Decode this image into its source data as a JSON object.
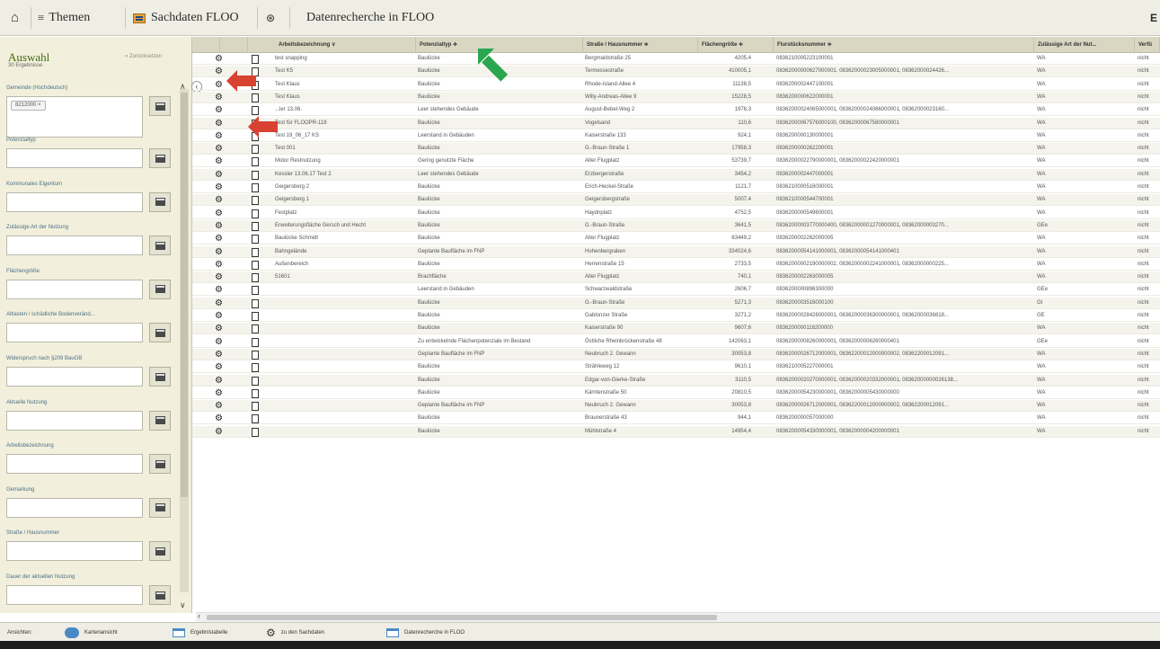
{
  "toolbar": {
    "themen": "Themen",
    "sachdaten": "Sachdaten FLOO",
    "title": "Datenrecherche in FLOO",
    "right_glyph": "E"
  },
  "sidebar": {
    "title": "Auswahl",
    "back": "« Zurücksetzen",
    "count": "30 Ergebnisse",
    "filters": [
      {
        "label": "Gemeinde (Hochdeutsch)",
        "chip": "8212000 ×"
      },
      {
        "label": "Potenzialtyp",
        "chip": ""
      },
      {
        "label": "Kommunales Eigentum",
        "chip": ""
      },
      {
        "label": "Zulässige Art der Nutzung",
        "chip": ""
      },
      {
        "label": "Flächengröße",
        "chip": ""
      },
      {
        "label": "Altlasten / schädliche Bodenveränd...",
        "chip": ""
      },
      {
        "label": "Widerspruch nach §209 BauGB",
        "chip": ""
      },
      {
        "label": "Aktuelle Nutzung",
        "chip": ""
      },
      {
        "label": "Arbeitsbezeichnung",
        "chip": ""
      },
      {
        "label": "Gemarkung",
        "chip": ""
      },
      {
        "label": "Straße / Hausnummer",
        "chip": ""
      },
      {
        "label": "Dauer der aktuellen Nutzung",
        "chip": ""
      }
    ]
  },
  "grid": {
    "headers": [
      "Arbeitsbezeichnung ∨",
      "Potenzialtyp ≑",
      "Straße / Hausnummer ≑",
      "Flächengröße ≑",
      "Flurstücksnummer ≑",
      "Zulässige Art der Nut...",
      "Verfü"
    ],
    "rows": [
      [
        "test snapping",
        "Baulücke",
        "Bergmaldstraße 25",
        "4205,4",
        "0836210005223100001",
        "WA",
        "nicht"
      ],
      [
        "Test K5",
        "Baulücke",
        "Termessestraße",
        "410005,1",
        "08362000000627000001, 08362000023005000001, 08362000024426...",
        "WA",
        "nicht"
      ],
      [
        "Test Klaus",
        "Baulücke",
        "Rhode-Island-Allee 4",
        "11138,5",
        "0836200002447100001",
        "WA",
        "nicht"
      ],
      [
        "Test Klaus",
        "Baulücke",
        "Willy-Andreas-Allee 9",
        "15228,5",
        "0836200000622000001",
        "WA",
        "nicht"
      ],
      [
        "...ler 13.06.",
        "Leer stehendes Gebäude",
        "August-Bebel-Weg 2",
        "1976,3",
        "08362000024065000001, 08362000024066000001, 08362000023160...",
        "WA",
        "nicht"
      ],
      [
        "Test für FLOOPR-118",
        "Baulücke",
        "Vogelsand",
        "110,6",
        "08362000067576000100, 08362000067580000001",
        "WA",
        "nicht"
      ],
      [
        "Test 19_06_17 KS",
        "Leerstand in Gebäuden",
        "Kaiserstraße 133",
        "924,1",
        "0836200000130000001",
        "WA",
        "nicht"
      ],
      [
        "Test 001",
        "Baulücke",
        "G.-Braun-Straße 1",
        "17958,3",
        "0836200000262200001",
        "WA",
        "nicht"
      ],
      [
        "Motor Restnutzung",
        "Gering genutzte Fläche",
        "Alter Flugplatz",
        "53739,7",
        "08362000022790000001, 08362000022420000001",
        "WA",
        "nicht"
      ],
      [
        "Kessler 13.06.17 Test 2",
        "Leer stehendes Gebäude",
        "Erzbergerstraße",
        "3454,2",
        "0836200002447000001",
        "WA",
        "nicht"
      ],
      [
        "Geigersberg 2",
        "Baulücke",
        "Erich-Heckel-Straße",
        "1121,7",
        "0836210000516000001",
        "WA",
        "nicht"
      ],
      [
        "Geigersberg 1",
        "Baulücke",
        "Geigersbergstraße",
        "5007,4",
        "0836210000544700001",
        "WA",
        "nicht"
      ],
      [
        "Festplatz",
        "Baulücke",
        "Haydnplatz",
        "4752,5",
        "0836200000549600001",
        "WA",
        "nicht"
      ],
      [
        "Erweiterungsfläche Gersch und Hecht",
        "Baulücke",
        "G.-Braun-Straße",
        "3641,5",
        "08362000003770000400, 08362000001270000001, 08362000003270...",
        "GEe",
        "nicht"
      ],
      [
        "Baulücke Schmidt",
        "Baulücke",
        "Alter Flugplatz",
        "63449,2",
        "0836200002262000005",
        "WA",
        "nicht"
      ],
      [
        "Bahngelände",
        "Geplante Baufläche im FNP",
        "Hohenbergraben",
        "334024,6",
        "08362000054141000001, 08362000054141000401",
        "WA",
        "nicht"
      ],
      [
        "Außenbereich",
        "Baulücke",
        "Herrenstraße 15",
        "2733,5",
        "08362000002190000002, 08362000002241000001, 08362000000225...",
        "WA",
        "nicht"
      ],
      [
        "51601",
        "Brachfläche",
        "Alter Flugplatz",
        "740,1",
        "0836200002263000005",
        "WA",
        "nicht"
      ],
      [
        "",
        "Leerstand in Gebäuden",
        "Schwarzwaldstraße",
        "2606,7",
        "0836200000896300000",
        "GEe",
        "nicht"
      ],
      [
        "",
        "Baulücke",
        "G.-Braun-Straße",
        "5271,3",
        "0836200003516000100",
        "GI",
        "nicht"
      ],
      [
        "",
        "Baulücke",
        "Gablonzer Straße",
        "3271,2",
        "08362000028428000001, 08362000036300000001, 08362000036818...",
        "GE",
        "nicht"
      ],
      [
        "",
        "Baulücke",
        "Kaiserstraße 90",
        "9607,6",
        "0836200000116200000",
        "WA",
        "nicht"
      ],
      [
        "",
        "Zu entwickelnde Flächenpotenziale im Bestand",
        "Östliche Rheinbrückenstraße 48",
        "142063,1",
        "08362000008260000001, 08362000006260000401",
        "GEe",
        "nicht"
      ],
      [
        "",
        "Geplante Baufläche im FNP",
        "Neubruch 2. Gewann",
        "30053,8",
        "08362000026712000001, 08362200012000000002, 08362200012091...",
        "WA",
        "nicht"
      ],
      [
        "",
        "Baulücke",
        "Strähleweg 12",
        "9610,1",
        "0836210005227000001",
        "WA",
        "nicht"
      ],
      [
        "",
        "Baulücke",
        "Edgar-von-Gierke-Straße",
        "3110,5",
        "08362000020270000001, 08362000020332000001, 08362000000026138...",
        "WA",
        "nicht"
      ],
      [
        "",
        "Baulücke",
        "Kärntenstraße 50",
        "20810,5",
        "08362000054230000001, 08362000005430000000",
        "WA",
        "nicht"
      ],
      [
        "",
        "Geplante Baufläche im FNP",
        "Neubruch 2. Gewann",
        "30053,8",
        "08362000026712000001, 08362200012000000002, 08362200012091...",
        "WA",
        "nicht"
      ],
      [
        "",
        "Baulücke",
        "Braunerstraße 43",
        "944,1",
        "0836200000057000000",
        "WA",
        "nicht"
      ],
      [
        "",
        "Baulücke",
        "Mühlstraße 4",
        "14954,4",
        "08362000054330000001, 08362000004200000001",
        "WA",
        "nicht"
      ]
    ]
  },
  "bottombar": {
    "label": "Ansichten:",
    "items": [
      "Kartenansicht",
      "Ergebnistabelle",
      "zu den Sachdaten",
      "Datenrecherche in FLOO"
    ]
  },
  "colors": {
    "accent_green": "#3d6a12",
    "arrow_red": "#d94131",
    "arrow_green": "#2aa64f"
  }
}
